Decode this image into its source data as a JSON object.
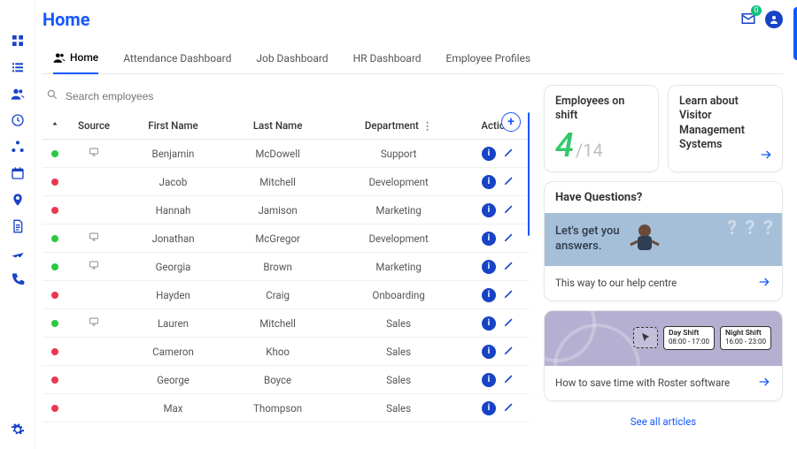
{
  "app": {
    "title": "Home",
    "notifications": "0"
  },
  "tabs": [
    {
      "label": "Home",
      "active": true,
      "icon": "users"
    },
    {
      "label": "Attendance Dashboard"
    },
    {
      "label": "Job Dashboard"
    },
    {
      "label": "HR Dashboard"
    },
    {
      "label": "Employee Profiles"
    }
  ],
  "search": {
    "placeholder": "Search employees"
  },
  "table": {
    "headers": {
      "source": "Source",
      "first": "First Name",
      "last": "Last Name",
      "dept": "Department",
      "actions": "Actions"
    },
    "rows": [
      {
        "status": "g",
        "device": true,
        "first": "Benjamin",
        "last": "McDowell",
        "dept": "Support"
      },
      {
        "status": "r",
        "device": false,
        "first": "Jacob",
        "last": "Mitchell",
        "dept": "Development"
      },
      {
        "status": "r",
        "device": false,
        "first": "Hannah",
        "last": "Jamison",
        "dept": "Marketing"
      },
      {
        "status": "g",
        "device": true,
        "first": "Jonathan",
        "last": "McGregor",
        "dept": "Development"
      },
      {
        "status": "g",
        "device": true,
        "first": "Georgia",
        "last": "Brown",
        "dept": "Marketing"
      },
      {
        "status": "r",
        "device": false,
        "first": "Hayden",
        "last": "Craig",
        "dept": "Onboarding"
      },
      {
        "status": "g",
        "device": true,
        "first": "Lauren",
        "last": "Mitchell",
        "dept": "Sales"
      },
      {
        "status": "r",
        "device": false,
        "first": "Cameron",
        "last": "Khoo",
        "dept": "Sales"
      },
      {
        "status": "r",
        "device": false,
        "first": "George",
        "last": "Boyce",
        "dept": "Sales"
      },
      {
        "status": "r",
        "device": false,
        "first": "Max",
        "last": "Thompson",
        "dept": "Sales"
      }
    ]
  },
  "cards": {
    "shift": {
      "title": "Employees on shift",
      "count": "4",
      "total": "/14"
    },
    "visitor": {
      "title": "Learn about Visitor Management Systems"
    }
  },
  "questions": {
    "heading": "Have Questions?",
    "banner_line1": "Let's get you",
    "banner_line2": "answers.",
    "link": "This way to our help centre"
  },
  "roster": {
    "chip1_title": "Day Shift",
    "chip1_time": "08:00 - 17:00",
    "chip2_title": "Night Shift",
    "chip2_time": "16:00 - 23:00",
    "link": "How to save time with Roster software"
  },
  "see_all": "See all articles"
}
